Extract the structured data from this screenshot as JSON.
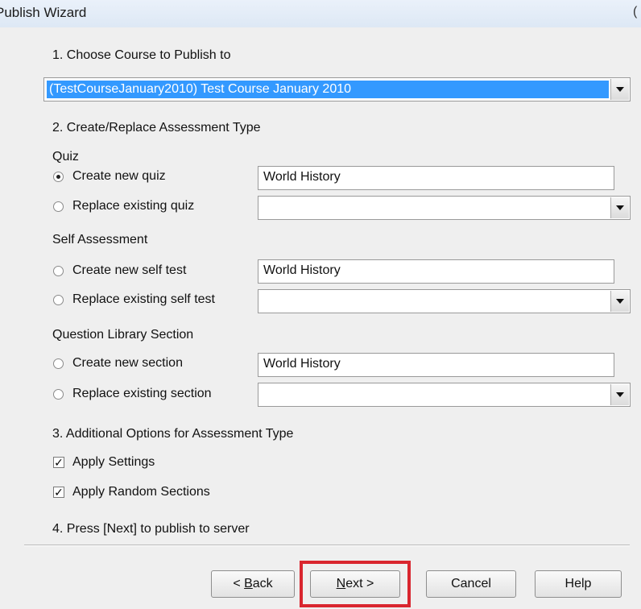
{
  "window": {
    "title": "Publish Wizard",
    "edge_glyph": "("
  },
  "step1": {
    "label": "1. Choose Course to Publish to",
    "course_selected": "(TestCourseJanuary2010) Test Course January 2010"
  },
  "step2": {
    "label": "2. Create/Replace Assessment Type",
    "quiz": {
      "header": "Quiz",
      "create_label": "Create new quiz",
      "create_value": "World History",
      "replace_label": "Replace existing quiz",
      "replace_value": "",
      "selected": "create"
    },
    "self": {
      "header": "Self Assessment",
      "create_label": "Create new self test",
      "create_value": "World History",
      "replace_label": "Replace existing self test",
      "replace_value": ""
    },
    "section": {
      "header": "Question Library Section",
      "create_label": "Create new section",
      "create_value": "World History",
      "replace_label": "Replace existing section",
      "replace_value": ""
    }
  },
  "step3": {
    "label": "3. Additional Options for Assessment Type",
    "apply_settings_label": "Apply Settings",
    "apply_settings_checked": true,
    "apply_random_label": "Apply Random Sections",
    "apply_random_checked": true,
    "check_glyph": "✓"
  },
  "step4": {
    "label": "4. Press [Next] to publish to server"
  },
  "buttons": {
    "back_prefix": "< ",
    "back_mnemonic": "B",
    "back_rest": "ack",
    "next_mnemonic": "N",
    "next_rest": "ext >",
    "cancel": "Cancel",
    "help": "Help"
  }
}
